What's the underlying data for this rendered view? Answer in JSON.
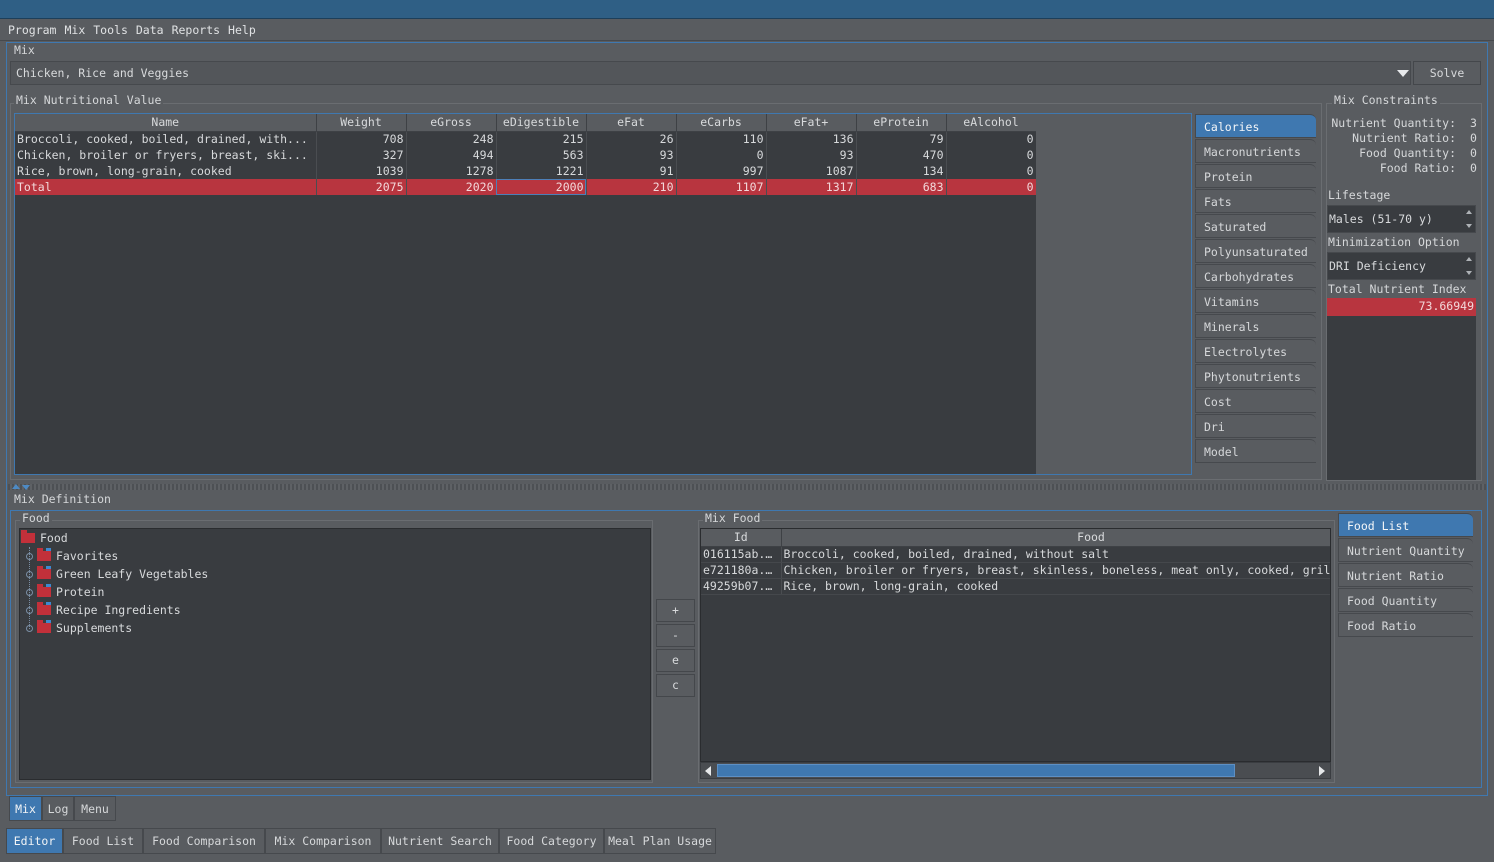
{
  "menu": [
    "Program",
    "Mix",
    "Tools",
    "Data",
    "Reports",
    "Help"
  ],
  "mix": {
    "group_label": "Mix",
    "selected": "Chicken, Rice and Veggies",
    "solve_label": "Solve"
  },
  "nutrition": {
    "group_label": "Mix Nutritional Value",
    "columns": [
      "Name",
      "Weight",
      "eGross",
      "eDigestible",
      "eFat",
      "eCarbs",
      "eFat+",
      "eProtein",
      "eAlcohol"
    ],
    "rows": [
      [
        "Broccoli, cooked, boiled, drained, with...",
        "708",
        "248",
        "215",
        "26",
        "110",
        "136",
        "79",
        "0"
      ],
      [
        "Chicken, broiler or fryers, breast, ski...",
        "327",
        "494",
        "563",
        "93",
        "0",
        "93",
        "470",
        "0"
      ],
      [
        "Rice, brown, long-grain, cooked",
        "1039",
        "1278",
        "1221",
        "91",
        "997",
        "1087",
        "134",
        "0"
      ]
    ],
    "total": [
      "Total",
      "2075",
      "2020",
      "2000",
      "210",
      "1107",
      "1317",
      "683",
      "0"
    ],
    "tabs": [
      "Calories",
      "Macronutrients",
      "Protein",
      "Fats",
      "Saturated",
      "Polyunsaturated",
      "Carbohydrates",
      "Vitamins",
      "Minerals",
      "Electrolytes",
      "Phytonutrients",
      "Cost",
      "Dri",
      "Model"
    ],
    "active_tab": "Calories"
  },
  "constraints": {
    "group_label": "Mix Constraints",
    "rows": [
      {
        "label": "Nutrient Quantity:",
        "value": "3"
      },
      {
        "label": "Nutrient Ratio:",
        "value": "0"
      },
      {
        "label": "Food Quantity:",
        "value": "0"
      },
      {
        "label": "Food Ratio:",
        "value": "0"
      }
    ],
    "lifestage_label": "Lifestage",
    "lifestage_value": "Males (51-70 y)",
    "minimization_label": "Minimization Option",
    "minimization_value": "DRI Deficiency",
    "tni_label": "Total Nutrient Index",
    "tni_value": "73.66949"
  },
  "definition": {
    "group_label": "Mix Definition",
    "food_label": "Food",
    "tree_root": "Food",
    "tree_children": [
      "Favorites",
      "Green Leafy Vegetables",
      "Protein",
      "Recipe Ingredients",
      "Supplements"
    ],
    "buttons": [
      "+",
      "-",
      "e",
      "c"
    ],
    "mixfood_label": "Mix Food",
    "mixfood_columns": [
      "Id",
      "Food"
    ],
    "mixfood_rows": [
      [
        "016115ab...",
        "Broccoli, cooked, boiled, drained, without salt"
      ],
      [
        "e721180a...",
        "Chicken, broiler or fryers, breast, skinless, boneless, meat only, cooked, grilled"
      ],
      [
        "49259b07...",
        "Rice, brown, long-grain, cooked"
      ]
    ],
    "right_tabs": [
      "Food List",
      "Nutrient Quantity",
      "Nutrient Ratio",
      "Food Quantity",
      "Food Ratio"
    ],
    "active_right_tab": "Food List"
  },
  "inner_tabs": [
    "Mix",
    "Log",
    "Menu"
  ],
  "bottom_tabs": [
    "Editor",
    "Food List",
    "Food Comparison",
    "Mix Comparison",
    "Nutrient Search",
    "Food Category",
    "Meal Plan Usage"
  ],
  "colors": {
    "accent": "#3f78b0",
    "highlight": "#b8353f",
    "folder": "#c2303a"
  }
}
